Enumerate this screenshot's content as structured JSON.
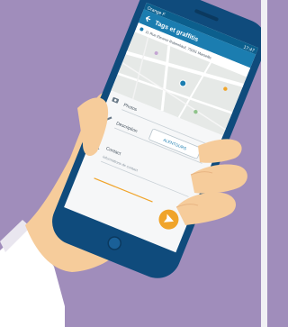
{
  "status_bar": {
    "carrier": "Orange F",
    "time": "17:47"
  },
  "app_bar": {
    "title": "Tags et graffitis",
    "back_icon": "arrow-left-icon"
  },
  "address_row": {
    "icon": "map-pin-icon",
    "text": "11 Rue Eleonor Rubenhauf, 75001 Marseille"
  },
  "form": {
    "photo_icon": "camera-icon",
    "photo_label": "Photos",
    "description_icon": "pencil-icon",
    "description_label": "Description",
    "details_button": "ALENTOURS",
    "contact_icon": "user-icon",
    "contact_label": "Contact",
    "contact_hint": "Informations de contact"
  },
  "fab": {
    "icon": "send-arrow-icon"
  },
  "colors": {
    "background": "#a08dbb",
    "phone_body": "#0f4b7c",
    "app_bar": "#1b7db0",
    "status_bar": "#0c5f8d",
    "fab": "#f0a42a",
    "skin": "#f6cc9b",
    "sleeve": "#ffffff"
  }
}
